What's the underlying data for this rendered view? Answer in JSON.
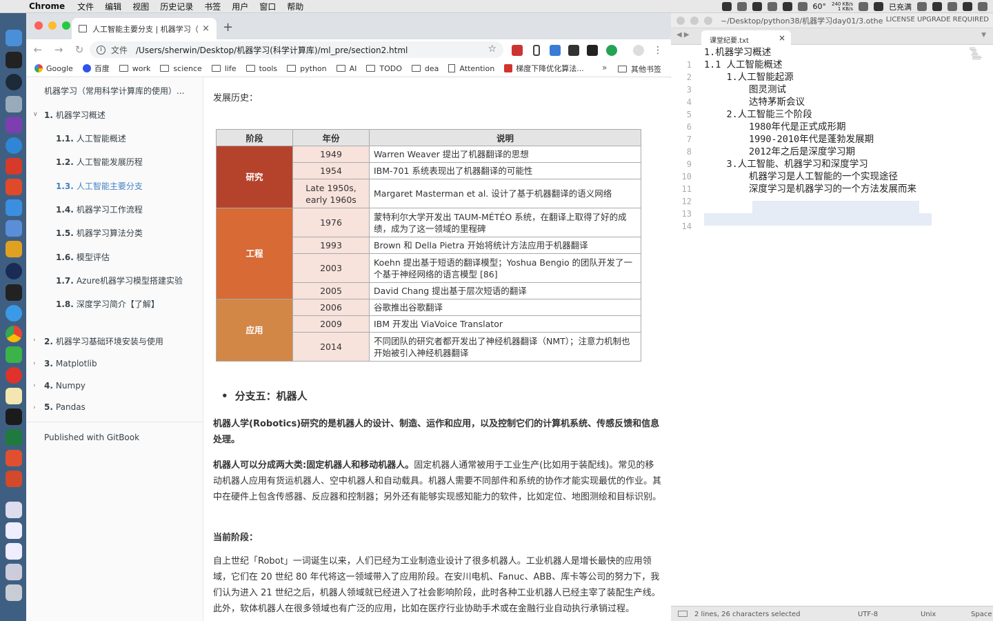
{
  "menubar": {
    "app": "Chrome",
    "items": [
      "文件",
      "编辑",
      "视图",
      "历史记录",
      "书签",
      "用户",
      "窗口",
      "帮助"
    ],
    "temp": "60°",
    "net_up": "240 KB/s",
    "net_down": "1 KB/s",
    "battery": "已充满"
  },
  "browser": {
    "tab_title": "人工智能主要分支 | 机器学习（",
    "url_scheme": "文件",
    "url": "/Users/sherwin/Desktop/机器学习(科学计算库)/ml_pre/section2.html",
    "bookmarks": [
      "Google",
      "百度",
      "work",
      "science",
      "life",
      "tools",
      "python",
      "AI",
      "TODO",
      "dea",
      "Attention",
      "梯度下降优化算法..."
    ],
    "more": "»",
    "other_bookmarks": "其他书签"
  },
  "sidebar": {
    "header": "机器学习（常用科学计算库的使用）...",
    "sections": [
      {
        "num": "1.",
        "label": "机器学习概述"
      },
      {
        "num": "2.",
        "label": "机器学习基础环境安装与使用"
      },
      {
        "num": "3.",
        "label": "Matplotlib"
      },
      {
        "num": "4.",
        "label": "Numpy"
      },
      {
        "num": "5.",
        "label": "Pandas"
      }
    ],
    "items": [
      {
        "num": "1.1.",
        "label": "人工智能概述"
      },
      {
        "num": "1.2.",
        "label": "人工智能发展历程"
      },
      {
        "num": "1.3.",
        "label": "人工智能主要分支"
      },
      {
        "num": "1.4.",
        "label": "机器学习工作流程"
      },
      {
        "num": "1.5.",
        "label": "机器学习算法分类"
      },
      {
        "num": "1.6.",
        "label": "模型评估"
      },
      {
        "num": "1.7.",
        "label": "Azure机器学习模型搭建实验"
      },
      {
        "num": "1.8.",
        "label": "深度学习简介【了解】"
      }
    ],
    "footer": "Published with GitBook"
  },
  "content": {
    "history_label": "发展历史：",
    "table": {
      "headers": [
        "阶段",
        "年份",
        "说明"
      ],
      "stages": [
        {
          "label": "研究",
          "color": "#b5432c"
        },
        {
          "label": "工程",
          "color": "#d76a35"
        },
        {
          "label": "应用",
          "color": "#d28747"
        }
      ],
      "rows": [
        {
          "year": "1949",
          "desc": "Warren Weaver 提出了机器翻译的思想"
        },
        {
          "year": "1954",
          "desc": "IBM-701 系统表现出了机器翻译的可能性"
        },
        {
          "year": "Late 1950s, early 1960s",
          "desc": "Margaret Masterman et al. 设计了基于机器翻译的语义网络"
        },
        {
          "year": "1976",
          "desc": "蒙特利尔大学开发出  TAUM-MÉTÉO 系统，在翻译上取得了好的成绩，成为了这一领域的里程碑"
        },
        {
          "year": "1993",
          "desc": "Brown 和 Della Pietra 开始将统计方法应用于机器翻译"
        },
        {
          "year": "2003",
          "desc": "Koehn 提出基于短语的翻译模型；Yoshua Bengio 的团队开发了一个基于神经网络的语言模型 [86]"
        },
        {
          "year": "2005",
          "desc": "David Chang 提出基于层次短语的翻译"
        },
        {
          "year": "2006",
          "desc": "谷歌推出谷歌翻译"
        },
        {
          "year": "2009",
          "desc": "IBM 开发出 ViaVoice Translator"
        },
        {
          "year": "2014",
          "desc": "不同团队的研究者都开发出了神经机器翻译（NMT）；注意力机制也开始被引入神经机器翻译"
        }
      ]
    },
    "bullet": "分支五：机器人",
    "p1": "机器人学(Robotics)研究的是机器人的设计、制造、运作和应用，以及控制它们的计算机系统、传感反馈和信息处理。",
    "p2_strong": "机器人可以分成两大类:固定机器人和移动机器人。",
    "p2": "固定机器人通常被用于工业生产(比如用于装配线)。常见的移动机器人应用有货运机器人、空中机器人和自动载具。机器人需要不同部件和系统的协作才能实现最优的作业。其中在硬件上包含传感器、反应器和控制器；另外还有能够实现感知能力的软件，比如定位、地图测绘和目标识别。",
    "p3": "当前阶段：",
    "p4": "自上世纪「Robot」一词诞生以来，人们已经为工业制造业设计了很多机器人。工业机器人是增长最快的应用领域，它们在 20 世纪 80 年代将这一领域带入了应用阶段。在安川电机、Fanuc、ABB、库卡等公司的努力下，我们认为进入 21 世纪之后，机器人领域就已经进入了社会影响阶段，此时各种工业机器人已经主宰了装配生产线。此外，软体机器人在很多领域也有广泛的应用，比如在医疗行业协助手术或在金融行业自动执行承销过程。"
  },
  "editor": {
    "path": "~/Desktop/python38/机器学习day01/3.othe",
    "license": "LICENSE UPGRADE REQUIRED",
    "tab": "课堂纪要.txt",
    "lines": [
      "1.机器学习概述",
      "1.1 人工智能概述",
      "    1.人工智能起源",
      "        图灵测试",
      "        达特茅斯会议",
      "    2.人工智能三个阶段",
      "        1980年代是正式成形期",
      "        1990-2010年代是蓬勃发展期",
      "        2012年之后是深度学习期",
      "    3.人工智能、机器学习和深度学习",
      "        机器学习是人工智能的一个实现途径",
      "        深度学习是机器学习的一个方法发展而来",
      "",
      ""
    ],
    "line_numbers": [
      "1",
      "2",
      "3",
      "4",
      "5",
      "6",
      "7",
      "8",
      "9",
      "10",
      "11",
      "12",
      "13",
      "14"
    ],
    "status": "2 lines, 26 characters selected",
    "encoding": "UTF-8",
    "line_endings": "Unix",
    "indent": "Space"
  }
}
